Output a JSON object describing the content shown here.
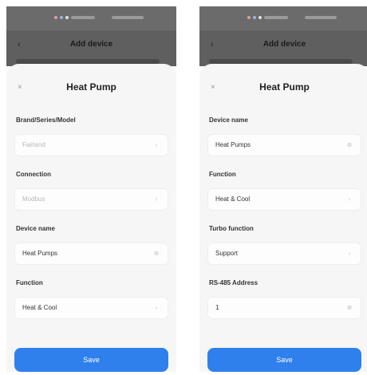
{
  "left": {
    "status_bar": {
      "icons": [
        "sim-icon",
        "wifi-icon",
        "battery-icon"
      ]
    },
    "nav_title": "Add device",
    "sheet_title": "Heat Pump",
    "fields": [
      {
        "label": "Brand/Series/Model",
        "value": "Fairland",
        "dim": true
      },
      {
        "label": "Connection",
        "value": "Modbus",
        "dim": true
      },
      {
        "label": "Device name",
        "value": "Heat Pumps",
        "dim": false
      },
      {
        "label": "Function",
        "value": "Heat & Cool",
        "dim": false
      }
    ],
    "save_label": "Save"
  },
  "right": {
    "status_bar": {
      "icons": [
        "sim-icon",
        "wifi-icon",
        "battery-icon"
      ]
    },
    "nav_title": "Add device",
    "sheet_title": "Heat Pump",
    "fields": [
      {
        "label": "Device name",
        "value": "Heat Pumps",
        "dim": false
      },
      {
        "label": "Function",
        "value": "Heat & Cool",
        "dim": false
      },
      {
        "label": "Turbo function",
        "value": "Support",
        "dim": false
      },
      {
        "label": "RS-485 Address",
        "value": "1",
        "dim": false
      }
    ],
    "save_label": "Save"
  },
  "colors": {
    "accent": "#2f80ed",
    "sheet_bg": "#f6f6f6",
    "overlay": "#5f5f5f"
  }
}
